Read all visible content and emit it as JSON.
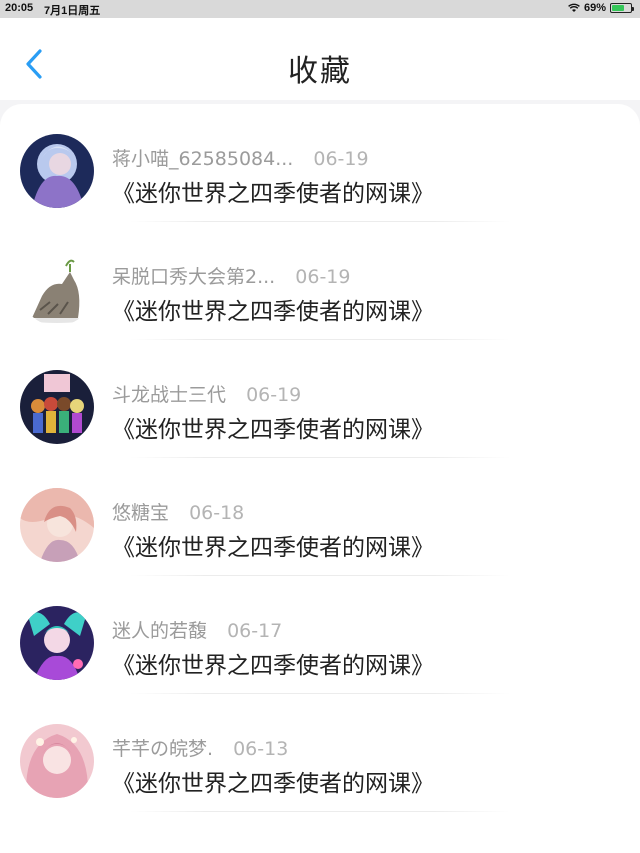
{
  "status_bar": {
    "time": "20:05",
    "date": "7月1日周五",
    "battery": "69%",
    "battery_level": 0.69,
    "icons": [
      "wifi-icon",
      "battery-icon"
    ]
  },
  "header": {
    "title": "收藏",
    "back_icon": "chevron-left-icon"
  },
  "colors": {
    "accent": "#2a9df4",
    "background": "#f4f4f6",
    "title_text": "#222222",
    "meta_text": "#9b9b9b",
    "battery_green": "#35c759"
  },
  "favorites": [
    {
      "author": "蒋小喵_62585084...",
      "date": "06-19",
      "title": "《迷你世界之四季使者的网课》"
    },
    {
      "author": "呆脱口秀大会第2...",
      "date": "06-19",
      "title": "《迷你世界之四季使者的网课》"
    },
    {
      "author": "斗龙战士三代",
      "date": "06-19",
      "title": "《迷你世界之四季使者的网课》"
    },
    {
      "author": "悠糖宝",
      "date": "06-18",
      "title": "《迷你世界之四季使者的网课》"
    },
    {
      "author": "迷人的若馥",
      "date": "06-17",
      "title": "《迷你世界之四季使者的网课》"
    },
    {
      "author": "芊芊の皖梦.",
      "date": "06-13",
      "title": "《迷你世界之四季使者的网课》"
    }
  ]
}
